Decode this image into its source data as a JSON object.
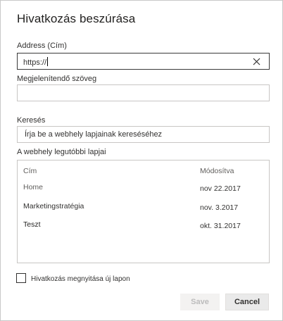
{
  "dialog": {
    "title": "Hivatkozás beszúrása",
    "address_label": "Address (Cím)",
    "address_value": "https://",
    "display_label": "Megjelenítendő szöveg",
    "display_value": "",
    "search_label": "Keresés",
    "search_placeholder": "Írja be a webhely lapjainak kereséséhez",
    "recent_label": "A webhely legutóbbi lapjai",
    "columns": {
      "name": "Cím",
      "modified": "Módosítva"
    },
    "rows": [
      {
        "name": "Home",
        "modified": "nov 22.2017",
        "name_color": "#605e5c"
      },
      {
        "name": "Marketingstratégia",
        "modified": "nov. 3.2017",
        "name_color": "#323130"
      },
      {
        "name": "Teszt",
        "modified": "okt. 31.2017",
        "name_color": "#201f1e"
      }
    ],
    "new_tab_label": "Hivatkozás megnyitása új lapon",
    "new_tab_checked": false,
    "save_label": "Save",
    "cancel_label": "Cancel",
    "icons": {
      "clear": "close-icon"
    }
  }
}
